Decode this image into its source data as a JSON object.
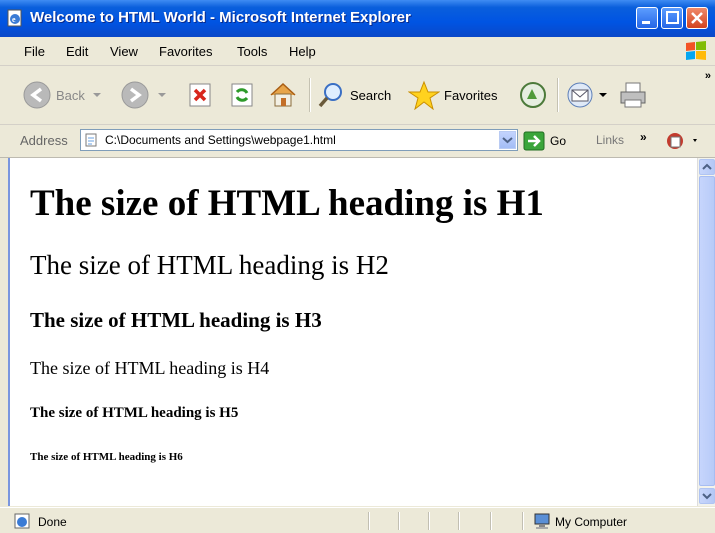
{
  "window": {
    "title": "Welcome to HTML World - Microsoft Internet Explorer"
  },
  "menu": {
    "items": [
      "File",
      "Edit",
      "View",
      "Favorites",
      "Tools",
      "Help"
    ]
  },
  "toolbar": {
    "back_label": "Back",
    "search_label": "Search",
    "favorites_label": "Favorites",
    "more_chevron": "»"
  },
  "address_bar": {
    "label": "Address",
    "value": "C:\\Documents and Settings\\webpage1.html",
    "go_label": "Go",
    "links_label": "Links",
    "links_chevron": "»"
  },
  "page": {
    "headings": [
      "The size of HTML heading is H1",
      "The size of HTML heading is H2",
      "The size of HTML heading is H3",
      "The size of HTML heading is H4",
      "The size of HTML heading is H5",
      "The size of HTML heading is H6"
    ]
  },
  "status_bar": {
    "status": "Done",
    "zone": "My Computer"
  },
  "colors": {
    "titlebar": "#0054e3",
    "chrome": "#ece9d8",
    "close_button": "#d2431f"
  }
}
